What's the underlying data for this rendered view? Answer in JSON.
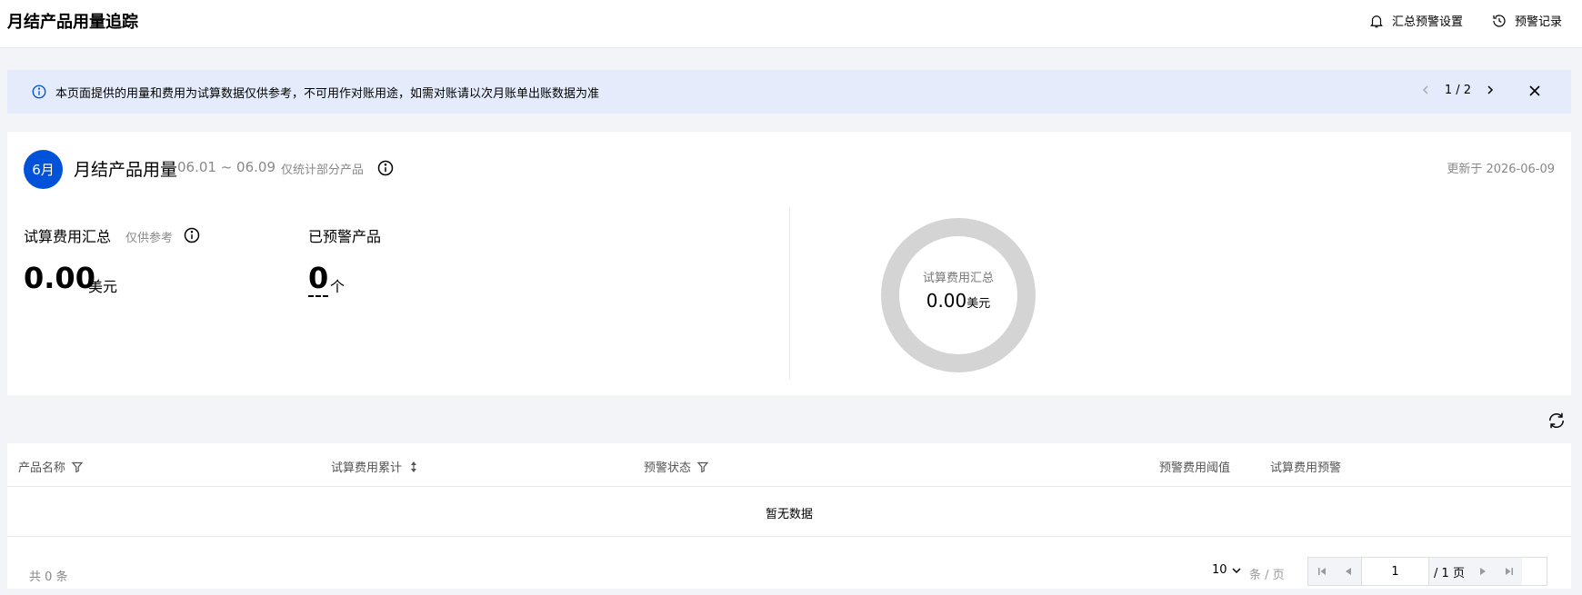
{
  "header": {
    "title": "月结产品用量追踪",
    "alert_settings_label": "汇总预警设置",
    "alert_records_label": "预警记录"
  },
  "notice": {
    "text": "本页面提供的用量和费用为试算数据仅供参考，不可用作对账用途，如需对账请以次月账单出账数据为准",
    "pager": "1 / 2"
  },
  "summary": {
    "month_badge": "6月",
    "title": "月结产品用量",
    "date_range": "06.01 ~ 06.09",
    "note": "仅统计部分产品",
    "updated": "更新于 2026-06-09",
    "cost_label": "试算费用汇总",
    "cost_sub": "仅供参考",
    "cost_value": "0.00",
    "cost_unit": "美元",
    "alerted_label": "已预警产品",
    "alerted_value": "0",
    "alerted_unit": "个"
  },
  "donut": {
    "label": "试算费用汇总",
    "value": "0.00",
    "unit": "美元",
    "ring_color": "#d4d4d4"
  },
  "table": {
    "columns": [
      "产品名称",
      "试算费用累计",
      "预警状态",
      "预警费用阈值",
      "试算费用预警"
    ],
    "empty_text": "暂无数据",
    "total": "共 0 条",
    "page_size": "10",
    "page_size_unit": "条 / 页",
    "current_page": "1",
    "total_pages": "/ 1 页"
  },
  "colors": {
    "accent": "#0052d9",
    "notice_bg": "#e4ecfb"
  }
}
